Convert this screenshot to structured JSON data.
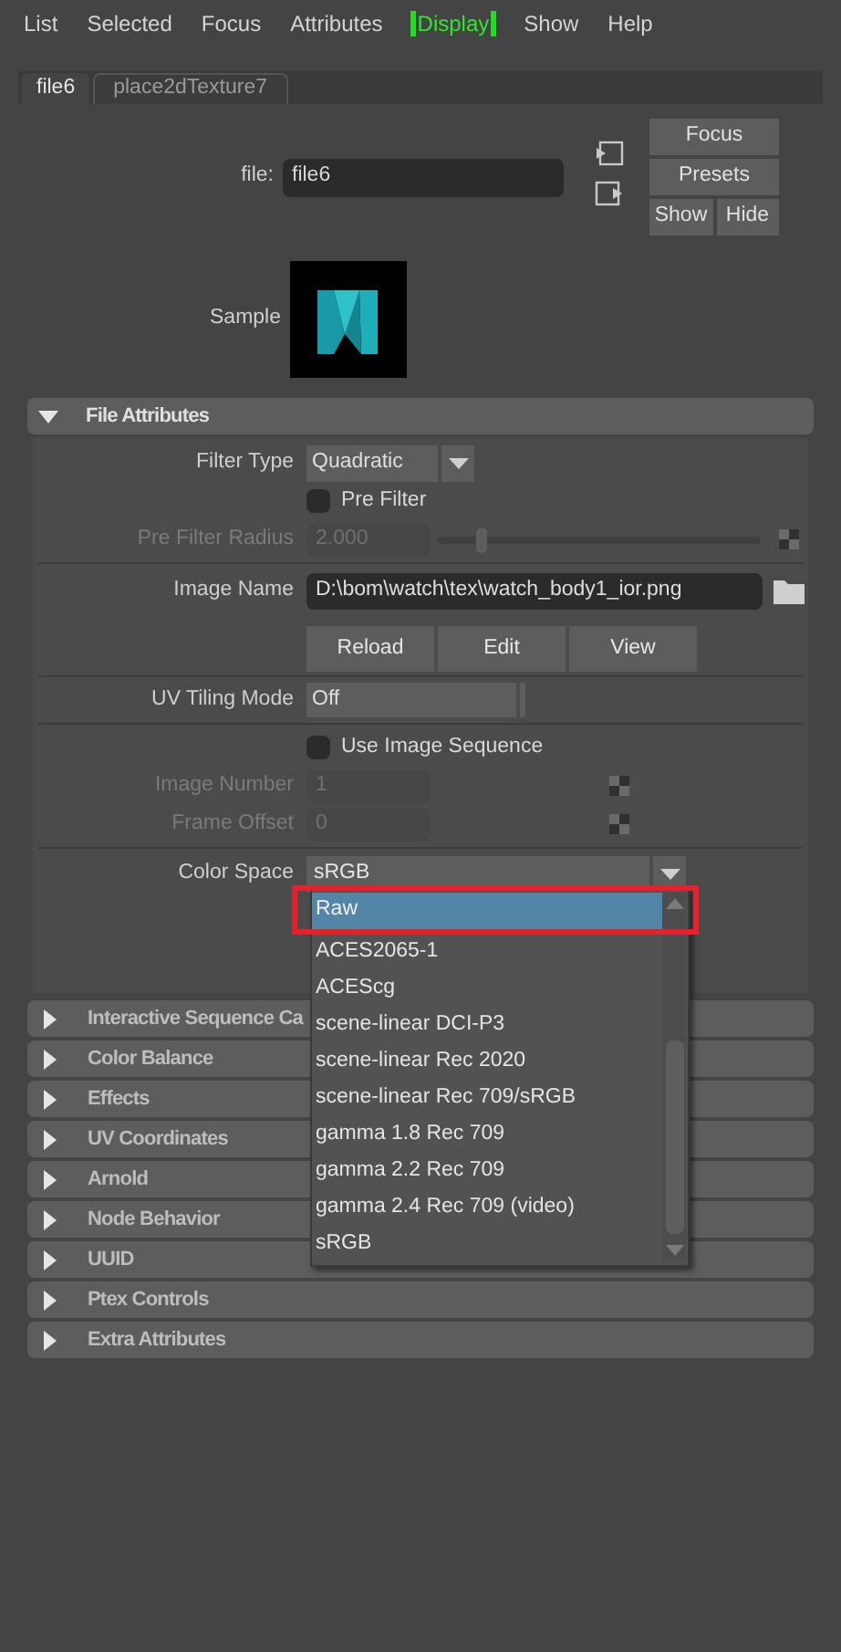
{
  "menu": [
    {
      "label": "List",
      "selected": false
    },
    {
      "label": "Selected",
      "selected": false
    },
    {
      "label": "Focus",
      "selected": false
    },
    {
      "label": "Attributes",
      "selected": false
    },
    {
      "label": "Display",
      "selected": true
    },
    {
      "label": "Show",
      "selected": false
    },
    {
      "label": "Help",
      "selected": false
    }
  ],
  "tabs": [
    {
      "label": "file6",
      "selected": true
    },
    {
      "label": "place2dTexture7",
      "selected": false
    }
  ],
  "node": {
    "file_label": "file:",
    "file_value": "file6",
    "buttons": [
      "Focus",
      "Presets",
      "Show",
      "Hide"
    ],
    "sample_label": "Sample"
  },
  "sections": [
    {
      "title": "File Attributes",
      "expanded": true,
      "rows": [
        {
          "kind": "dropdown",
          "label": "Filter Type",
          "value": "Quadratic"
        },
        {
          "kind": "checkbox",
          "label": "Pre Filter",
          "checked": false
        },
        {
          "kind": "slider",
          "label": "Pre Filter Radius",
          "value": "2.000",
          "level": 0.12,
          "disabled": true
        },
        {
          "kind": "divider"
        },
        {
          "kind": "path",
          "label": "Image Name",
          "value": "D:\\bom\\watch\\tex\\watch_body1_ior.png"
        },
        {
          "kind": "buttons",
          "buttons": [
            "Reload",
            "Edit",
            "View"
          ]
        },
        {
          "kind": "divider"
        },
        {
          "kind": "select",
          "label": "UV Tiling Mode",
          "value": "Off"
        },
        {
          "kind": "divider"
        },
        {
          "kind": "checkbox",
          "label": "Use Image Sequence",
          "checked": false
        },
        {
          "kind": "number",
          "label": "Image Number",
          "value": "1",
          "disabled": true
        },
        {
          "kind": "number",
          "label": "Frame Offset",
          "value": "0",
          "disabled": true
        },
        {
          "kind": "divider"
        },
        {
          "kind": "wide_dropdown",
          "label": "Color Space",
          "value": "sRGB"
        }
      ]
    },
    {
      "title": "Interactive Sequence Ca",
      "expanded": false
    },
    {
      "title": "Color Balance",
      "expanded": false
    },
    {
      "title": "Effects",
      "expanded": false
    },
    {
      "title": "UV Coordinates",
      "expanded": false
    },
    {
      "title": "Arnold",
      "expanded": false
    },
    {
      "title": "Node Behavior",
      "expanded": false
    },
    {
      "title": "UUID",
      "expanded": false
    },
    {
      "title": "Ptex Controls",
      "expanded": false
    },
    {
      "title": "Extra Attributes",
      "expanded": false
    }
  ],
  "color_space_list": [
    {
      "label": "Raw",
      "selected": true,
      "annotated": true
    },
    {
      "label": "ACES2065-1",
      "selected": false,
      "annotated": false
    },
    {
      "label": "ACEScg",
      "selected": false,
      "annotated": false
    },
    {
      "label": "scene-linear DCI-P3",
      "selected": false,
      "annotated": false
    },
    {
      "label": "scene-linear Rec 2020",
      "selected": false,
      "annotated": false
    },
    {
      "label": "scene-linear Rec 709/sRGB",
      "selected": false,
      "annotated": false
    },
    {
      "label": "gamma 1.8 Rec 709",
      "selected": false,
      "annotated": false
    },
    {
      "label": "gamma 2.2 Rec 709",
      "selected": false,
      "annotated": false
    },
    {
      "label": "gamma 2.4 Rec 709 (video)",
      "selected": false,
      "annotated": false
    },
    {
      "label": "sRGB",
      "selected": false,
      "annotated": false
    }
  ]
}
